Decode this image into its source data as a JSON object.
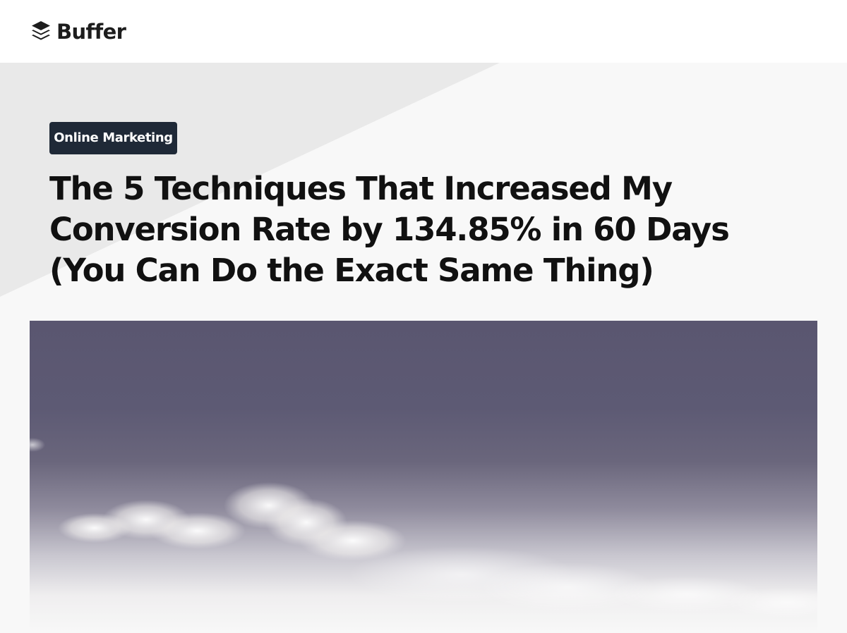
{
  "brand": {
    "name": "Buffer",
    "logo_icon": "buffer-stack-icon",
    "color": "#1d1d1d"
  },
  "article": {
    "category": "Online Marketing",
    "title_lines": [
      "The 5 Techniques That Increased My",
      "Conversion Rate by 134.85% in 60 Days",
      "(You Can Do the Exact Same Thing)"
    ]
  },
  "hero_image": {
    "subject": "sky-with-clouds-photo"
  },
  "colors": {
    "tag_background": "#1f2937",
    "title_text": "#111111",
    "hero_diagonal": "#e9e9e9",
    "page_background": "#f8f8f8"
  }
}
